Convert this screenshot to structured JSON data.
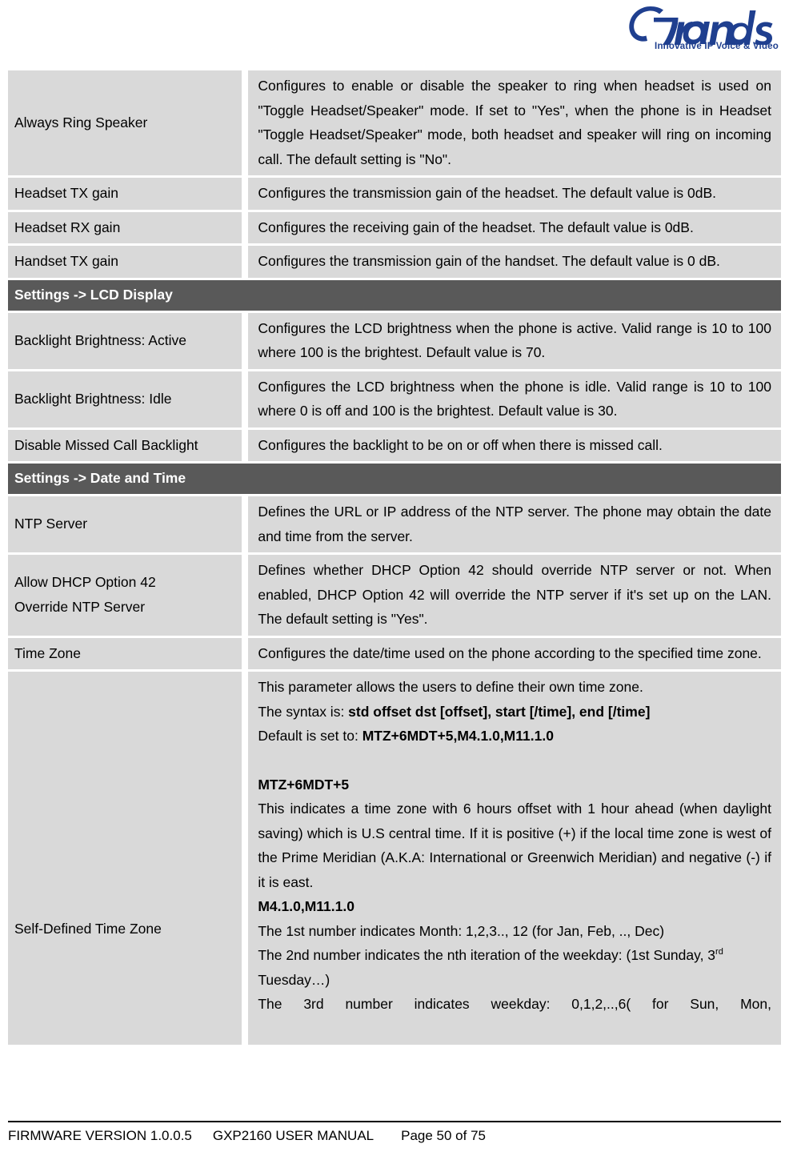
{
  "header": {
    "logo_name": "Grandstream",
    "logo_tagline": "Innovative IP Voice & Video",
    "brand_color": "#1f3f8f"
  },
  "table": {
    "section_header_bg": "#595959",
    "row_bg": "#d9d9d9",
    "rows": [
      {
        "type": "data",
        "name": "Always Ring Speaker",
        "desc": "Configures to enable or disable the speaker to ring when headset is used on \"Toggle Headset/Speaker\" mode. If set to \"Yes\", when the phone is in Headset \"Toggle Headset/Speaker\" mode, both headset and speaker will ring on incoming call. The default setting is \"No\"."
      },
      {
        "type": "data",
        "name": "Headset TX gain",
        "desc": "Configures the transmission gain of the headset. The default value is 0dB."
      },
      {
        "type": "data",
        "name": "Headset RX gain",
        "desc": "Configures the receiving gain of the headset. The default value is 0dB."
      },
      {
        "type": "data",
        "name": "Handset TX gain",
        "desc": "Configures the transmission gain of the handset. The default value is 0 dB."
      },
      {
        "type": "section",
        "title": "Settings -> LCD Display"
      },
      {
        "type": "data",
        "name": "Backlight Brightness: Active",
        "desc": "Configures the LCD brightness when the phone is active. Valid range is 10 to 100 where 100 is the brightest. Default value is 70."
      },
      {
        "type": "data",
        "name": "Backlight Brightness: Idle",
        "desc": "Configures the LCD brightness when the phone is idle. Valid range is 10 to 100 where 0 is off and 100 is the brightest. Default value is 30."
      },
      {
        "type": "data",
        "name": "Disable Missed Call Backlight",
        "desc": "Configures the backlight to be on or off when there is missed call."
      },
      {
        "type": "section",
        "title": "Settings -> Date and Time"
      },
      {
        "type": "data",
        "name": "NTP Server",
        "desc": "Defines the URL or IP address of the NTP server. The phone may obtain the date and time from the server."
      },
      {
        "type": "data",
        "name": "Allow DHCP Option 42 Override NTP Server",
        "name_line_1": "Allow DHCP Option 42",
        "name_line_2": "Override NTP Server",
        "desc": "Defines whether DHCP Option 42 should override NTP server or not. When enabled, DHCP Option 42 will override the NTP server if it's set up on the LAN. The default setting is \"Yes\"."
      },
      {
        "type": "data",
        "name": "Time Zone",
        "desc": "Configures the date/time used on the phone according to the specified time zone."
      }
    ],
    "self_defined": {
      "name": "Self-Defined Time Zone",
      "line_intro": "This parameter allows the users to define their own time zone.",
      "line_syntax_prefix": "The syntax is: ",
      "line_syntax_bold": "std offset dst [offset], start [/time], end [/time]",
      "line_default_prefix": "Default is set to: ",
      "line_default_bold": "MTZ+6MDT+5,M4.1.0,M11.1.0",
      "heading_mtz": "MTZ+6MDT+5",
      "para_mtz": "This indicates a time zone with 6 hours offset with 1 hour ahead (when daylight saving) which is U.S central time. If it is positive (+) if the local time zone is west of the Prime Meridian (A.K.A: International or Greenwich Meridian) and negative (-) if it is east.",
      "heading_m4": "M4.1.0,M11.1.0",
      "line_1st": "The 1st number indicates Month: 1,2,3.., 12 (for Jan, Feb, .., Dec)",
      "line_2nd": "The 2nd number indicates the nth iteration of the weekday: (1st Sunday, 3",
      "line_2nd_sup": "rd",
      "line_2nd_tail": " Tuesday…)",
      "line_3rd": "The 3rd number indicates weekday: 0,1,2,..,6( for Sun, Mon,"
    }
  },
  "footer": {
    "firmware": "FIRMWARE VERSION 1.0.0.5",
    "manual": "GXP2160 USER MANUAL",
    "page": "Page 50 of 75"
  }
}
